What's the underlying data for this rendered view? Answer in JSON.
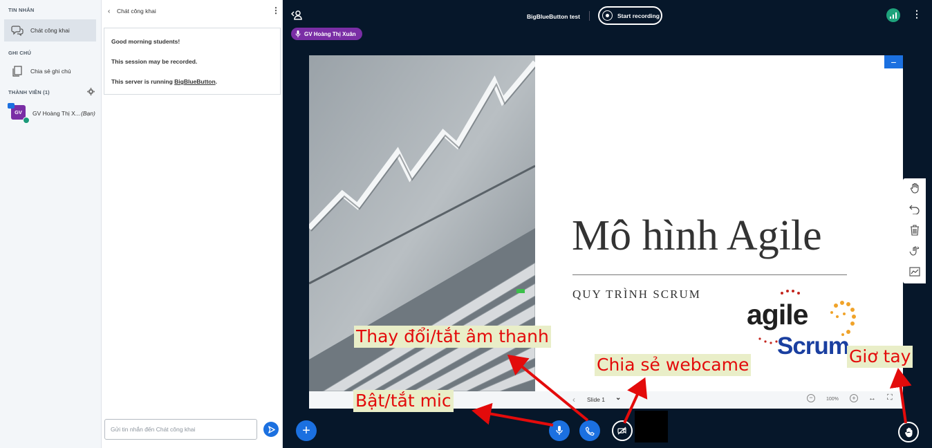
{
  "sidebar": {
    "messages_heading": "TIN NHẮN",
    "public_chat_label": "Chát công khai",
    "notes_heading": "GHI CHÚ",
    "shared_notes_label": "Chia sẻ ghi chú",
    "users_heading": "THÀNH VIÊN (1)",
    "user": {
      "avatar_text": "GV",
      "name": "GV Hoàng Thị X...",
      "you_tag": "(Bạn)"
    }
  },
  "chat": {
    "title": "Chát công khai",
    "messages": [
      "Good morning students!",
      "This session may be recorded.",
      "This server is running "
    ],
    "link_text": "BigBlueButton",
    "link_suffix": ".",
    "input_placeholder": "Gửi tin nhắn đến Chát công khai"
  },
  "main": {
    "meeting_title": "BigBlueButton test",
    "record_label": "Start recording",
    "talking_user": "GV Hoàng Thị Xuân",
    "colors": {
      "accent": "#1b70e0",
      "background": "#06172a",
      "talker": "#7a2ea5",
      "annotation": "#e30b0b"
    }
  },
  "slide": {
    "title": "Mô hình Agile",
    "subtitle": "QUY TRÌNH SCRUM",
    "logo_agile": "agile",
    "logo_scrum": "Scrum",
    "nav_label": "Slide 1",
    "zoom": "100%"
  },
  "annotations": {
    "audio": "Thay đổi/tắt âm thanh",
    "mic": "Bật/tắt mic",
    "webcam": "Chia sẻ webcame",
    "raise_hand": "Giơ tay"
  }
}
